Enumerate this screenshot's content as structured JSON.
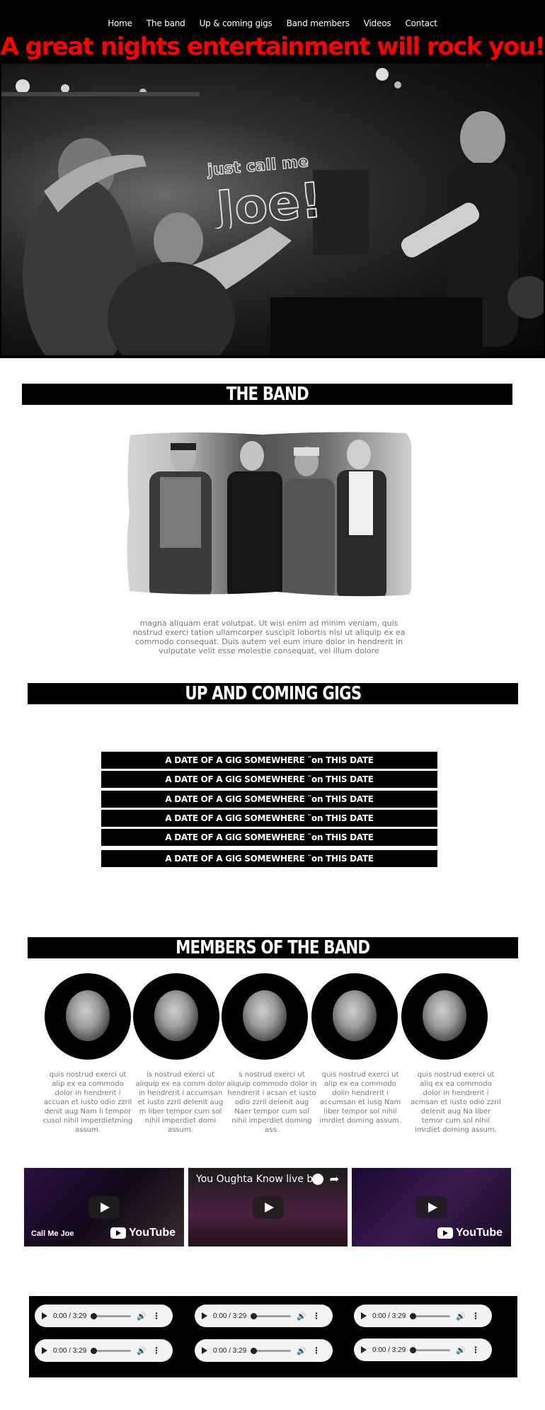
{
  "nav": {
    "items": [
      "Home",
      "The band",
      "Up & coming gigs",
      "Band members",
      "Videos",
      "Contact"
    ]
  },
  "hero": {
    "title": "A great nights entertainment will rock you!",
    "logo_text_top": "just call me",
    "logo_text_main": "Joe!"
  },
  "sections": {
    "band_title": "THE BAND",
    "gigs_title": "UP AND COMING GIGS",
    "members_title": "MEMBERS OF THE BAND"
  },
  "band": {
    "paragraph": "magna aliquam erat volutpat. Ut wisi enim ad minim veniam, quis nostrud exerci tation ullamcorper suscipit lobortis nisl ut aliquip ex ea commodo consequat. Duis autem vel eum iriure dolor in hendrerit in vulputate velit esse molestie consequat, vel illum dolore"
  },
  "gigs": [
    "A DATE OF A GIG SOMEWHERE ¨on THIS DATE",
    "A DATE OF A GIG SOMEWHERE ¨on THIS DATE",
    "A DATE OF A GIG SOMEWHERE ¨on THIS DATE",
    "A DATE OF A GIG SOMEWHERE ¨on THIS DATE",
    "A DATE OF A GIG SOMEWHERE ¨on THIS DATE",
    "A DATE OF A GIG SOMEWHERE ¨on THIS DATE"
  ],
  "members": [
    "quis nostrud exerci ut alip ex ea commodo dolor in hendrerit i accuan et iusto odio zzril denit aug Nam li tempor cusol nihil imperdietming assum.",
    "is nostrud exerci ut aliquip ex ea comm dolor in hendrerit i accumsan et iusto zzril delenit aug m liber tempor cum sol nihil imperdiet domi assum.",
    "s nostrud exerci ut aliquip commodo dolor in hendrerit i acsan et iusto odio zzril delenit aug Naer tempor cum sol nihil imperdiet doming ass.",
    "quis nostrud exerci ut alip ex ea commodo dolin hendrerit i accumsan et iusg Nam liber tempor sol nihil imrdiet doming assum.",
    "quis nostrud exerci ut aliq ex ea commodo dolor in hendrerit i acmsan et iusto odio zzril delenit aug Na liber temor cum sol nihil imrdiet doming assum."
  ],
  "videos": [
    {
      "title": "",
      "caption_line1": "Call Me Joe",
      "brand": "YouTube"
    },
    {
      "title": "You Oughta Know live b...",
      "caption_line1": "",
      "brand": ""
    },
    {
      "title": "",
      "caption_line1": "",
      "brand": "YouTube"
    }
  ],
  "audio": {
    "time": "0:00 / 3:29",
    "players": 6
  }
}
